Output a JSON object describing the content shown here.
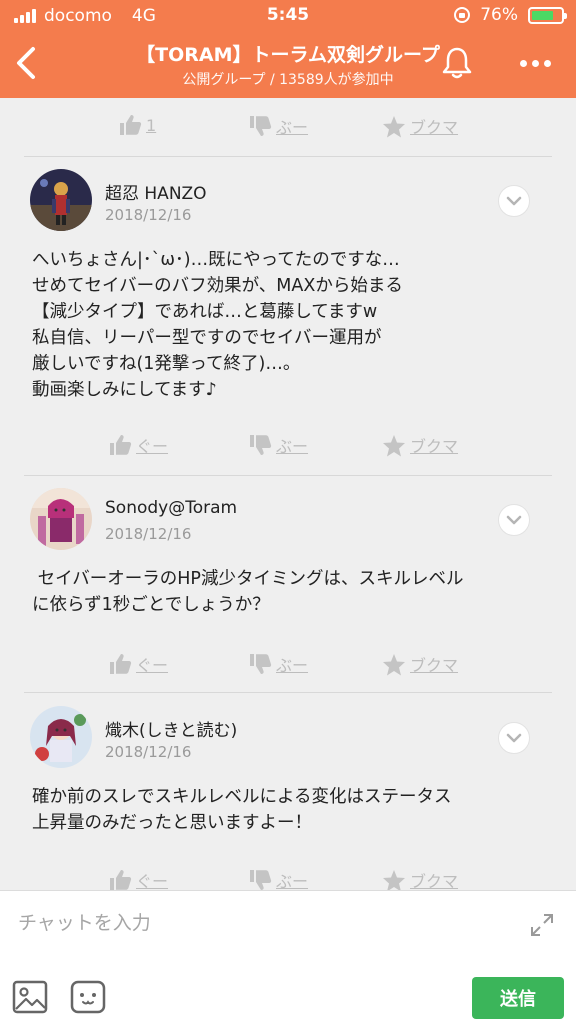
{
  "status_bar": {
    "carrier": "docomo",
    "network": "4G",
    "time": "5:45",
    "battery": "76%",
    "battery_level": 0.76,
    "battery_color": "#4cd964"
  },
  "header": {
    "title": "【TORAM】トーラム双剣グループ",
    "subtitle": "公開グループ / 13589人が参加中",
    "background_color": "#f47c4d",
    "back_icon": "chevron-left-icon",
    "bell_icon": "bell-icon",
    "more_icon": "more-dots-icon"
  },
  "top_actions": {
    "like_label": "1",
    "dislike_label": "ぶー",
    "bookmark_label": "ブクマ"
  },
  "posts": [
    {
      "author": "超忍 HANZO",
      "date": "2018/12/16",
      "text": "へいちょさん|･`ω･)…既にやってたのですな…\nせめてセイバーのバフ効果が、MAXから始まる\n【減少タイプ】であれば…と葛藤してますw\n私自信、リーパー型ですのでセイバー運用が\n厳しいですね(1発撃って終了)…。\n動画楽しみにしてます♪",
      "like_label": "ぐー",
      "dislike_label": "ぶー",
      "bookmark_label": "ブクマ"
    },
    {
      "author": "Sonody@Toram",
      "date": "2018/12/16",
      "text": " セイバーオーラのHP減少タイミングは、スキルレベル\nに依らず1秒ごとでしょうか？",
      "like_label": "ぐー",
      "dislike_label": "ぶー",
      "bookmark_label": "ブクマ"
    },
    {
      "author": "熾木(しきと読む)",
      "date": "2018/12/16",
      "text": "確か前のスレでスキルレベルによる変化はステータス\n上昇量のみだったと思いますよー！",
      "like_label": "ぐー",
      "dislike_label": "ぶー",
      "bookmark_label": "ブクマ"
    }
  ],
  "composer": {
    "placeholder": "チャットを入力",
    "send_label": "送信",
    "send_color": "#3bb55a",
    "image_icon": "image-icon",
    "sticker_icon": "sticker-icon",
    "expand_icon": "expand-icon"
  }
}
